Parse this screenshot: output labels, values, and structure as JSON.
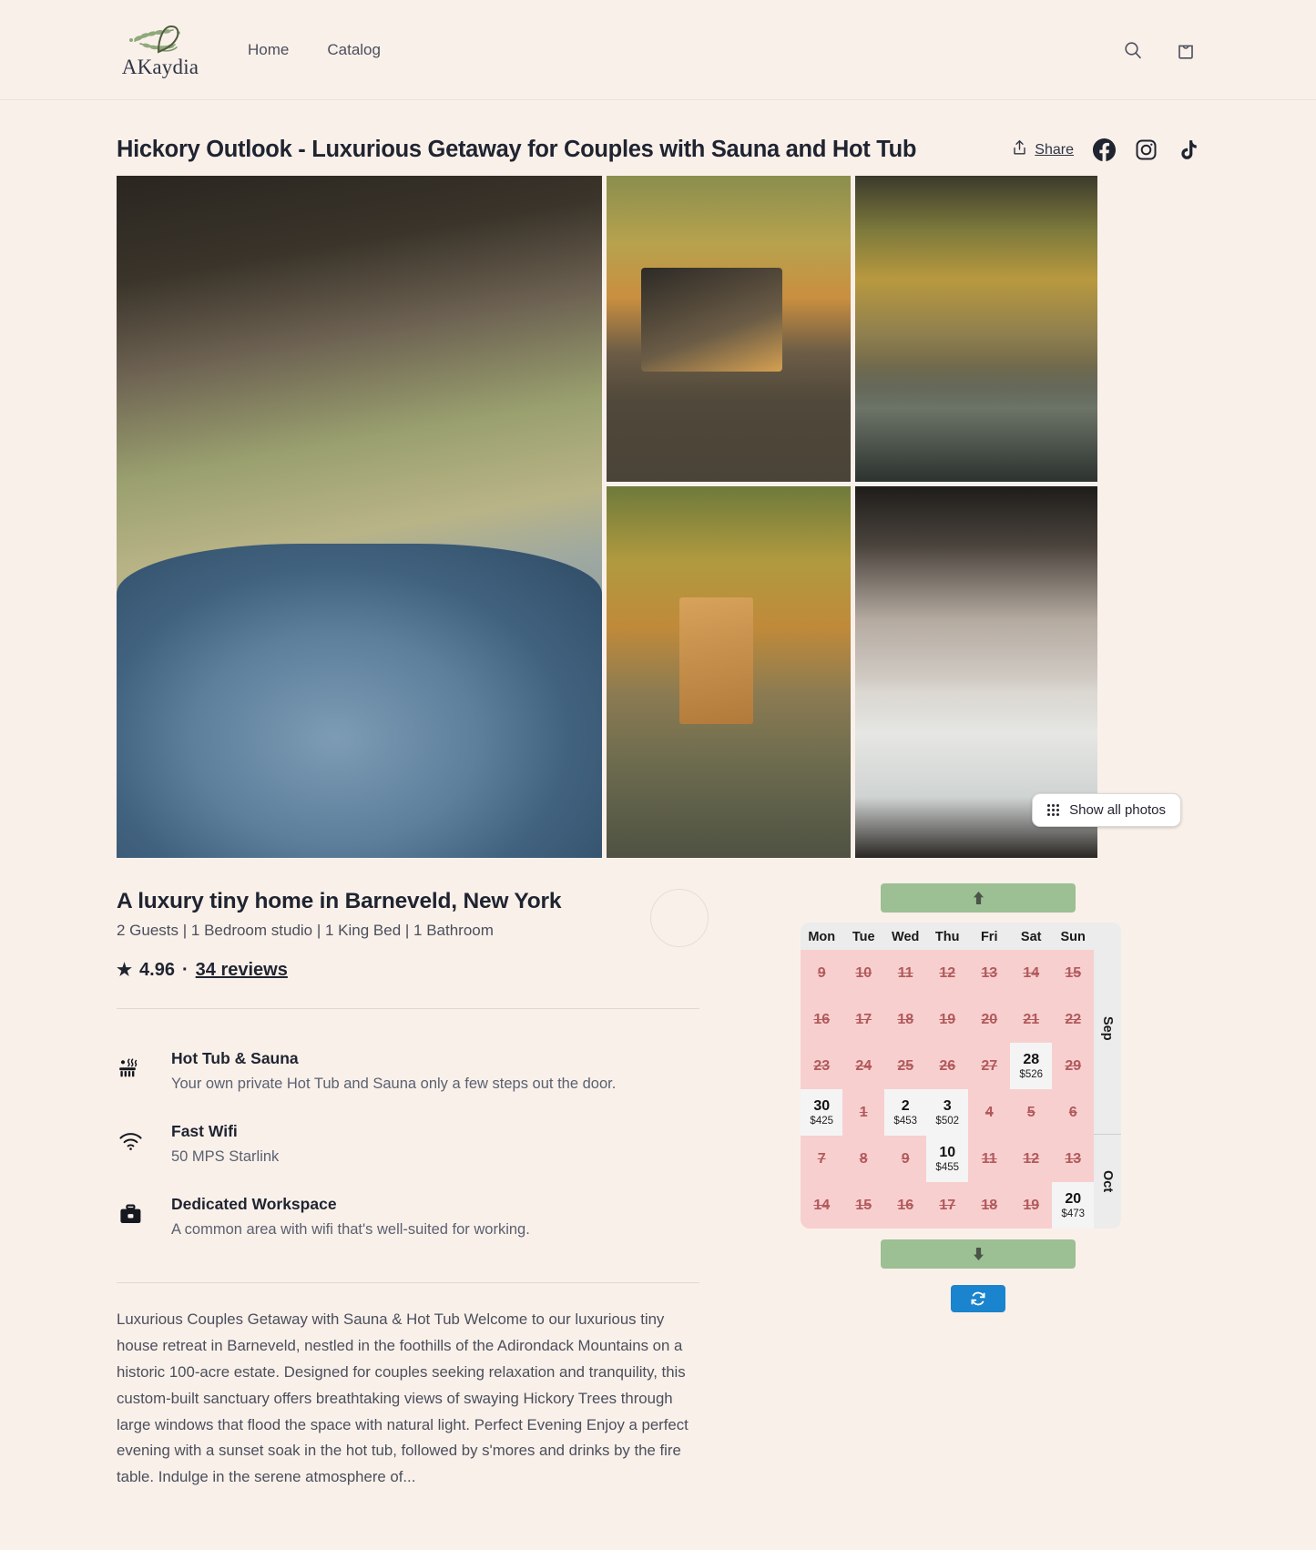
{
  "header": {
    "brand_name": "AKaydia",
    "nav": [
      {
        "label": "Home"
      },
      {
        "label": "Catalog"
      }
    ],
    "actions": [
      {
        "name": "search-icon",
        "label": "Search"
      },
      {
        "name": "cart-icon",
        "label": "Cart"
      }
    ]
  },
  "listing": {
    "title": "Hickory Outlook - Luxurious Getaway for Couples with Sauna and Hot Tub",
    "share_label": "Share",
    "socials": [
      {
        "name": "facebook-icon",
        "label": "Facebook"
      },
      {
        "name": "instagram-icon",
        "label": "Instagram"
      },
      {
        "name": "tiktok-icon",
        "label": "TikTok"
      }
    ],
    "show_all_photos_label": "Show all photos",
    "subtitle": "A luxury tiny home in Barneveld, New York",
    "meta": "2 Guests | 1 Bedroom studio | 1 King Bed | 1 Bathroom",
    "rating_value": "4.96",
    "rating_separator": "·",
    "reviews_label": "34 reviews",
    "star_glyph": "★",
    "description": "Luxurious Couples Getaway with Sauna & Hot Tub Welcome to our luxurious tiny house retreat in Barneveld, nestled in the foothills of the Adirondack Mountains on a historic 100-acre estate. Designed for couples seeking relaxation and tranquility, this custom-built sanctuary offers breathtaking views of swaying Hickory Trees through large windows that flood the space with natural light. Perfect Evening Enjoy a perfect evening with a sunset soak in the hot tub, followed by s'mores and drinks by the fire table. Indulge in the serene atmosphere of..."
  },
  "amenities": [
    {
      "icon": "hot-tub-icon",
      "title": "Hot Tub & Sauna",
      "subtitle": "Your own private Hot Tub and Sauna only a few steps out the door."
    },
    {
      "icon": "wifi-icon",
      "title": "Fast Wifi",
      "subtitle": "50 MPS Starlink"
    },
    {
      "icon": "briefcase-icon",
      "title": "Dedicated Workspace",
      "subtitle": "A common area with wifi that's well-suited for working."
    }
  ],
  "calendar": {
    "scroll_up_label": "Scroll up",
    "scroll_down_label": "Scroll down",
    "refresh_label": "Refresh",
    "weekdays": [
      "Mon",
      "Tue",
      "Wed",
      "Thu",
      "Fri",
      "Sat",
      "Sun"
    ],
    "months": [
      {
        "label": "Sep"
      },
      {
        "label": "Oct"
      }
    ],
    "colors": {
      "blocked_bg": "#F8CFCF",
      "blocked_text": "#B15A5C",
      "available_bg": "#F4F4F4",
      "available_text": "#111111",
      "scroll_button": "#9CBF94",
      "refresh_button": "#1A84CE"
    },
    "weeks": [
      [
        {
          "num": "9",
          "price": "",
          "state": "blocked"
        },
        {
          "num": "10",
          "price": "",
          "state": "blocked"
        },
        {
          "num": "11",
          "price": "",
          "state": "blocked"
        },
        {
          "num": "12",
          "price": "",
          "state": "blocked"
        },
        {
          "num": "13",
          "price": "",
          "state": "blocked"
        },
        {
          "num": "14",
          "price": "",
          "state": "blocked"
        },
        {
          "num": "15",
          "price": "",
          "state": "blocked"
        }
      ],
      [
        {
          "num": "16",
          "price": "",
          "state": "blocked"
        },
        {
          "num": "17",
          "price": "",
          "state": "blocked"
        },
        {
          "num": "18",
          "price": "",
          "state": "blocked"
        },
        {
          "num": "19",
          "price": "",
          "state": "blocked"
        },
        {
          "num": "20",
          "price": "",
          "state": "blocked"
        },
        {
          "num": "21",
          "price": "",
          "state": "blocked"
        },
        {
          "num": "22",
          "price": "",
          "state": "blocked"
        }
      ],
      [
        {
          "num": "23",
          "price": "",
          "state": "blocked"
        },
        {
          "num": "24",
          "price": "",
          "state": "blocked"
        },
        {
          "num": "25",
          "price": "",
          "state": "blocked"
        },
        {
          "num": "26",
          "price": "",
          "state": "blocked"
        },
        {
          "num": "27",
          "price": "",
          "state": "blocked"
        },
        {
          "num": "28",
          "price": "$526",
          "state": "available"
        },
        {
          "num": "29",
          "price": "",
          "state": "blocked"
        }
      ],
      [
        {
          "num": "30",
          "price": "$425",
          "state": "available"
        },
        {
          "num": "1",
          "price": "",
          "state": "blocked"
        },
        {
          "num": "2",
          "price": "$453",
          "state": "available"
        },
        {
          "num": "3",
          "price": "$502",
          "state": "available"
        },
        {
          "num": "4",
          "price": "",
          "state": "blocked"
        },
        {
          "num": "5",
          "price": "",
          "state": "blocked"
        },
        {
          "num": "6",
          "price": "",
          "state": "blocked"
        }
      ],
      [
        {
          "num": "7",
          "price": "",
          "state": "blocked"
        },
        {
          "num": "8",
          "price": "",
          "state": "blocked"
        },
        {
          "num": "9",
          "price": "",
          "state": "blocked"
        },
        {
          "num": "10",
          "price": "$455",
          "state": "available"
        },
        {
          "num": "11",
          "price": "",
          "state": "blocked"
        },
        {
          "num": "12",
          "price": "",
          "state": "blocked"
        },
        {
          "num": "13",
          "price": "",
          "state": "blocked"
        }
      ],
      [
        {
          "num": "14",
          "price": "",
          "state": "blocked"
        },
        {
          "num": "15",
          "price": "",
          "state": "blocked"
        },
        {
          "num": "16",
          "price": "",
          "state": "blocked"
        },
        {
          "num": "17",
          "price": "",
          "state": "blocked"
        },
        {
          "num": "18",
          "price": "",
          "state": "blocked"
        },
        {
          "num": "19",
          "price": "",
          "state": "blocked"
        },
        {
          "num": "20",
          "price": "$473",
          "state": "available"
        }
      ]
    ]
  },
  "gallery": [
    {
      "name": "photo-hot-tub-deck"
    },
    {
      "name": "photo-cabin-exterior-jeep"
    },
    {
      "name": "photo-porch-chairs"
    },
    {
      "name": "photo-sauna-pumpkins"
    },
    {
      "name": "photo-bedroom"
    }
  ]
}
